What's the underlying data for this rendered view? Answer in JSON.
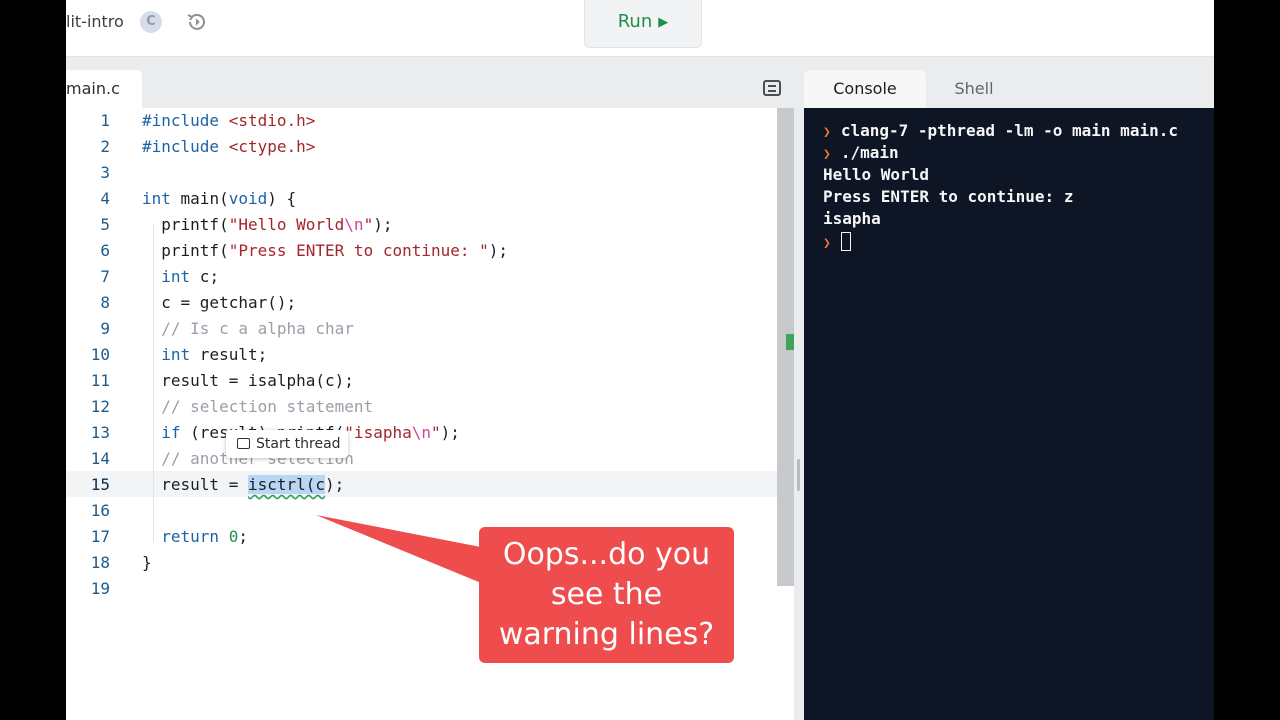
{
  "header": {
    "repl_name": "lit-intro",
    "lang_icon": "C",
    "run_label": "Run"
  },
  "editor": {
    "file_tab": "main.c",
    "start_thread_label": "Start thread",
    "lines": [
      "1",
      "2",
      "3",
      "4",
      "5",
      "6",
      "7",
      "8",
      "9",
      "10",
      "11",
      "12",
      "13",
      "14",
      "15",
      "16",
      "17",
      "18",
      "19"
    ]
  },
  "console": {
    "tabs": [
      "Console",
      "Shell"
    ],
    "output": [
      "clang-7 -pthread -lm -o main main.c",
      "./main",
      "Hello World",
      "Press ENTER to continue: z",
      "isapha"
    ]
  },
  "callout": {
    "line1": "Oops...do you",
    "line2": "see the",
    "line3": "warning lines?"
  },
  "colors": {
    "run_green": "#1f8f4a",
    "console_bg": "#0e1525",
    "prompt_orange": "#e8773a",
    "callout_red": "#ef4d4d"
  }
}
